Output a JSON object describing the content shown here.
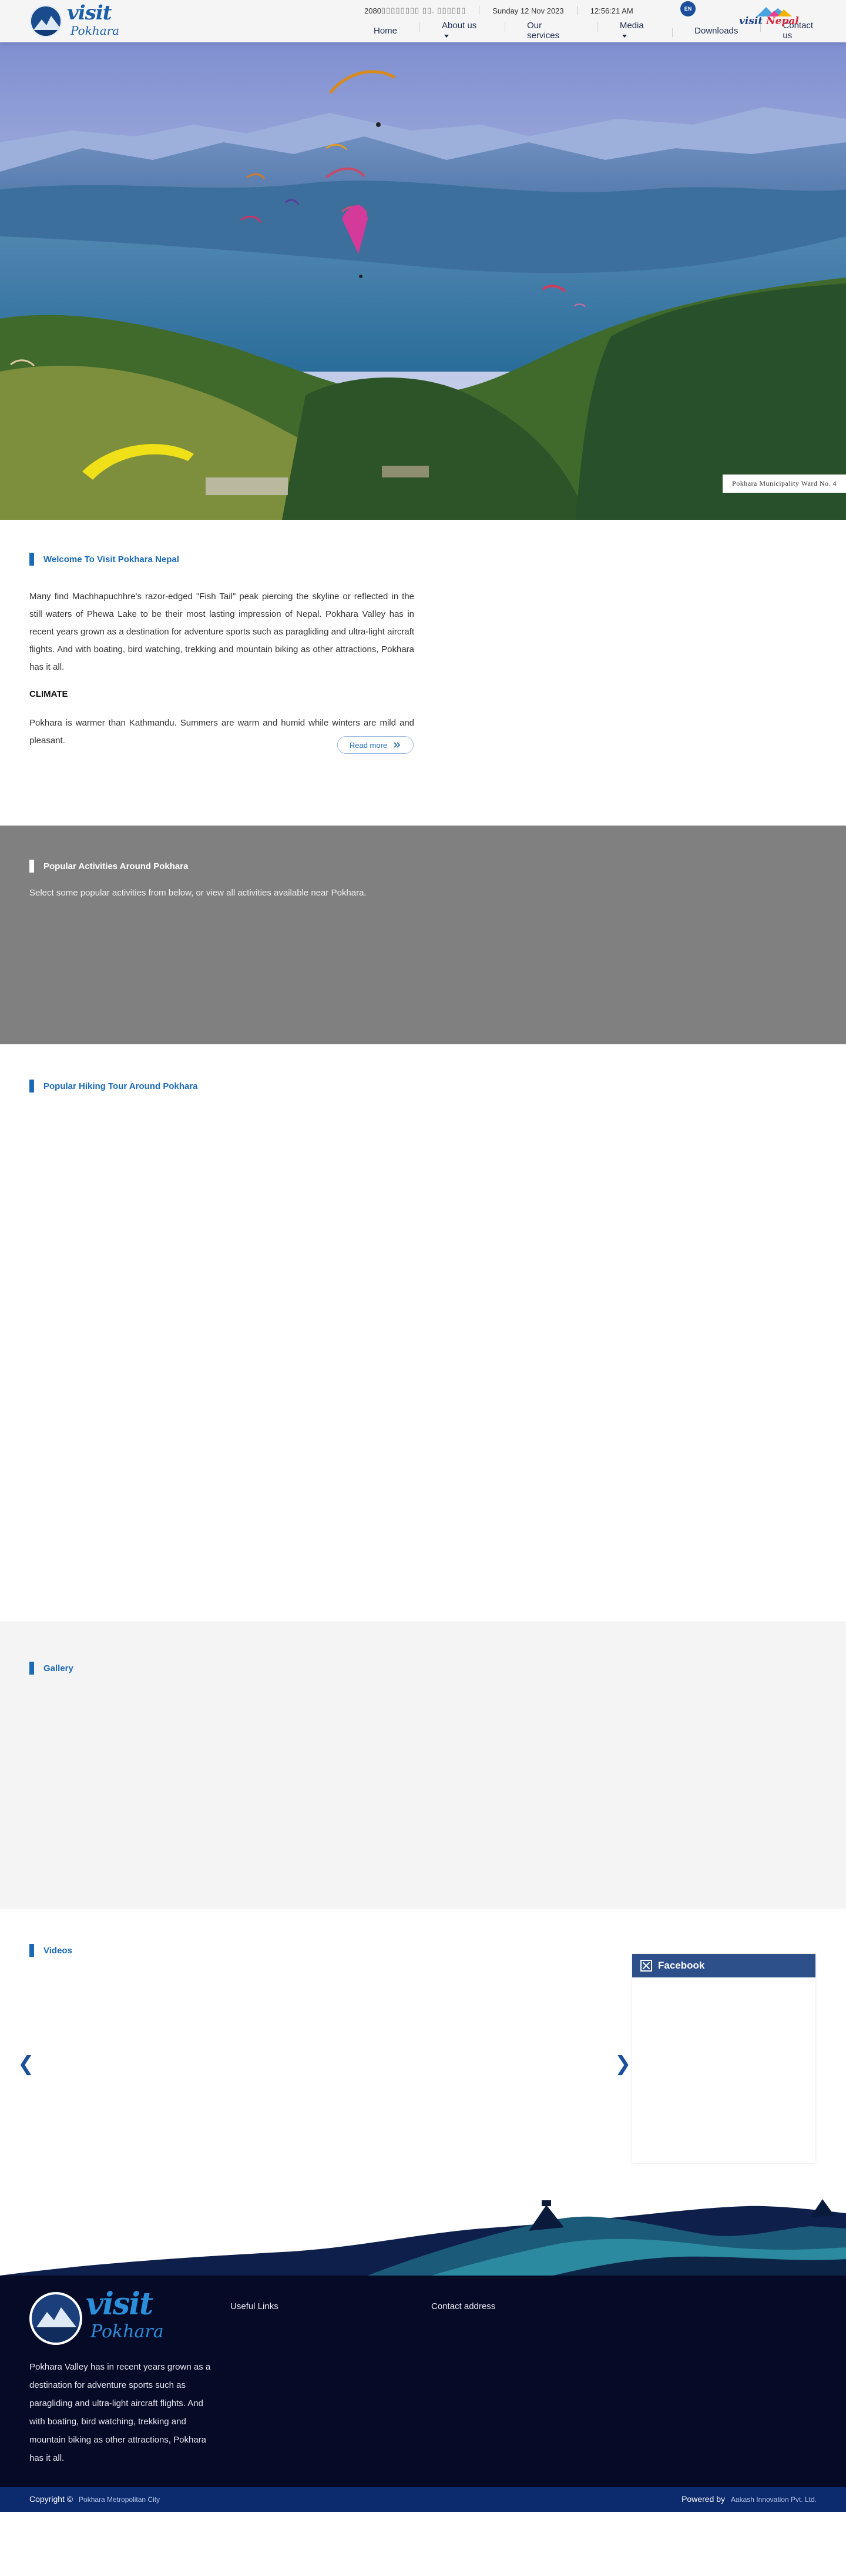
{
  "header": {
    "logo": {
      "word1": "visit",
      "word2": "Pokhara"
    },
    "nepali_date": "2080 ",
    "date": "Sunday 12 Nov 2023",
    "time": "12:56:21 AM",
    "lang_button": "EN",
    "nav": [
      {
        "label": "Home",
        "dropdown": false
      },
      {
        "label": "About us",
        "dropdown": true
      },
      {
        "label": "Our services",
        "dropdown": false
      },
      {
        "label": "Media",
        "dropdown": true
      },
      {
        "label": "Downloads",
        "dropdown": false
      },
      {
        "label": "Contact us",
        "dropdown": false
      }
    ],
    "visit_nepal": {
      "word1": "visit",
      "word2": "Nepal"
    }
  },
  "hero": {
    "caption": "Pokhara Municipality Ward No. 4"
  },
  "welcome": {
    "title": "Welcome To Visit Pokhara Nepal",
    "body": "Many find Machhapuchhre's razor-edged \"Fish Tail\" peak piercing the skyline or reflected in the still waters of Phewa Lake to be their most lasting impression of Nepal. Pokhara Valley has in recent years grown as a destination for adventure sports such as paragliding and ultra-light aircraft flights. And with boating, bird watching, trekking and mountain biking as other attractions, Pokhara has it all.",
    "climate_title": "CLIMATE",
    "climate_body": "Pokhara is warmer than Kathmandu. Summers are warm and humid while winters are mild and pleasant.",
    "read_more": "Read more"
  },
  "activities": {
    "title": "Popular Activities Around Pokhara",
    "subtitle": "Select some popular activities from below, or view all activities available near Pokhara."
  },
  "hiking": {
    "title": "Popular Hiking Tour Around Pokhara"
  },
  "gallery": {
    "title": "Gallery"
  },
  "videos": {
    "title": "Videos",
    "prev": "❮",
    "next": "❯"
  },
  "facebook": {
    "title": "Facebook"
  },
  "footer": {
    "logo": {
      "word1": "visit",
      "word2": "Pokhara"
    },
    "description": "Pokhara Valley has in recent years grown as a destination for adventure sports such as paragliding and ultra-light aircraft flights. And with boating, bird watching, trekking and mountain biking as other attractions, Pokhara has it all.",
    "useful_links": "Useful Links",
    "contact_address": "Contact address",
    "copyright_label": "Copyright ©",
    "copyright_owner": "Pokhara Metropolitan City",
    "powered_label": "Powered by",
    "powered_owner": "Aakash Innovation Pvt. Ltd."
  },
  "colors": {
    "accent": "#1b6ab8",
    "nav_text": "#1d2b4f",
    "activities_bg": "#808080",
    "gallery_bg": "#f4f4f4",
    "footer_bg": "#050a26",
    "copyright_bg": "#0c2a6e",
    "facebook_blue": "#2d4f8a"
  },
  "icons": [
    "caret-down-icon",
    "double-chevron-right-icon",
    "chevron-left-icon",
    "chevron-right-icon",
    "facebook-icon"
  ]
}
